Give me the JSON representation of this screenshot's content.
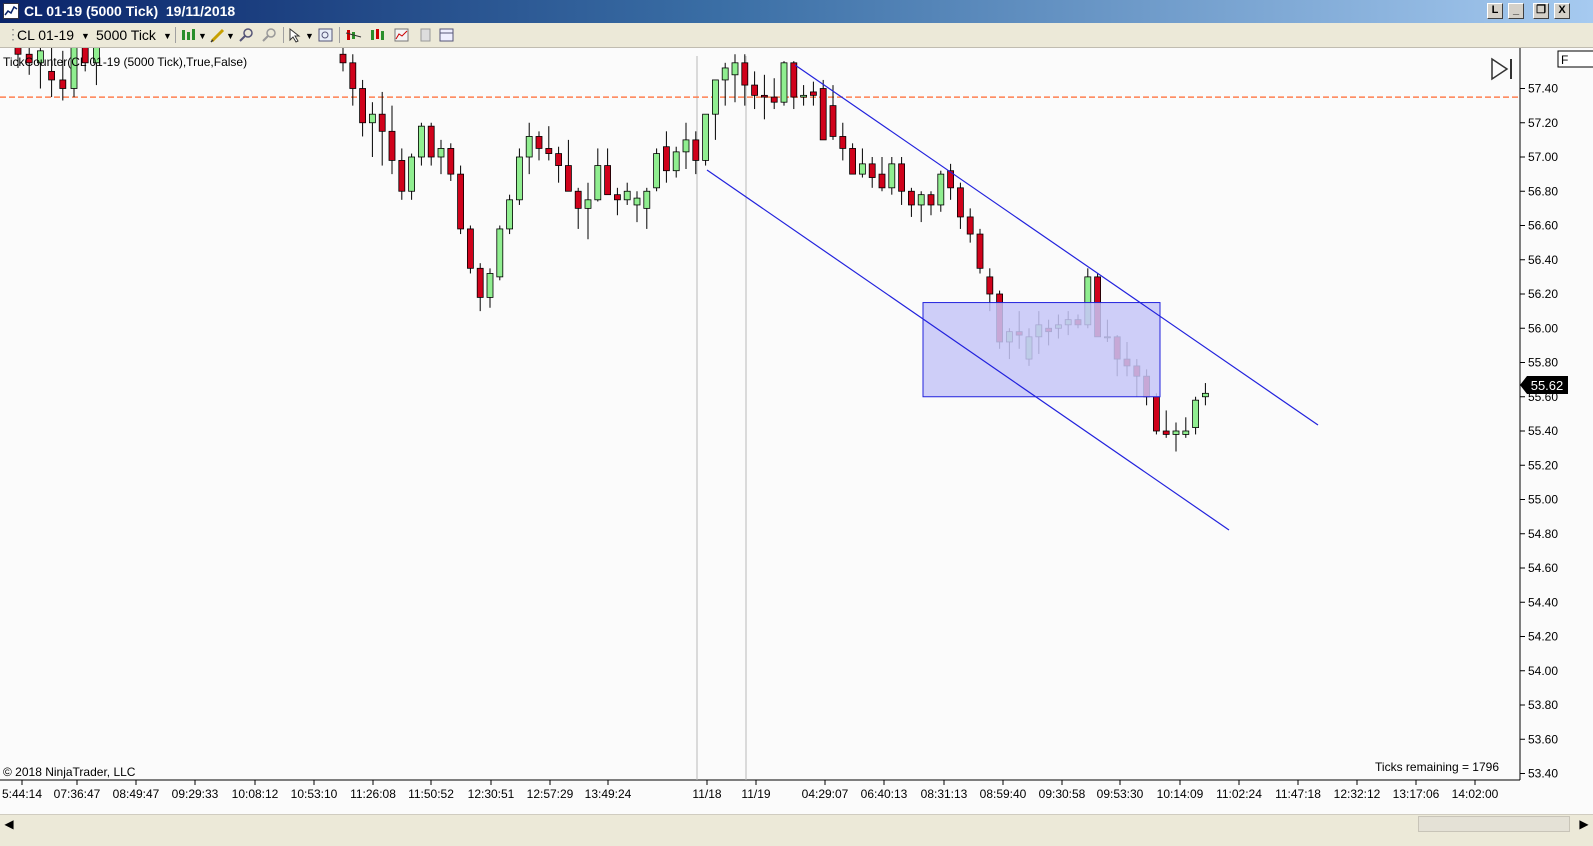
{
  "window": {
    "title": "CL 01-19 (5000 Tick)  19/11/2018",
    "buttons": [
      "L",
      "_",
      "❐",
      "X"
    ]
  },
  "toolbar": {
    "instrument": "CL 01-19",
    "period": "5000 Tick"
  },
  "indicator_label": "TickCounter(CL 01-19 (5000 Tick),True,False)",
  "copyright": "© 2018 NinjaTrader, LLC",
  "ticks_remaining": "Ticks remaining = 1796",
  "last_price": "55.62",
  "price_axis_partial_label": "F",
  "colors": {
    "up_candle": "#90ee90",
    "down_candle": "#d0021b",
    "channel": "#2222dd",
    "zone_fill": "#c5c5f7",
    "level_line": "#ff7f50"
  },
  "chart_data": {
    "type": "candlestick",
    "ylim": [
      53.3,
      57.6
    ],
    "y_ticks": [
      57.4,
      57.2,
      57.0,
      56.8,
      56.6,
      56.4,
      56.2,
      56.0,
      55.8,
      55.6,
      55.4,
      55.2,
      55.0,
      54.8,
      54.6,
      54.4,
      54.2,
      54.0,
      53.8,
      53.6,
      53.4
    ],
    "x_tick_labels": [
      "5:44:14",
      "07:36:47",
      "08:49:47",
      "09:29:33",
      "10:08:12",
      "10:53:10",
      "11:26:08",
      "11:50:52",
      "12:30:51",
      "12:57:29",
      "13:49:24",
      "11/18",
      "11/19",
      "04:29:07",
      "06:40:13",
      "08:31:13",
      "08:59:40",
      "09:30:58",
      "09:53:30",
      "10:14:09",
      "11:02:24",
      "11:47:18",
      "12:32:12",
      "13:17:06",
      "14:02:00"
    ],
    "session_breaks": [
      "11/18",
      "11/19"
    ],
    "horizontal_level": 57.35,
    "last_price": 55.62,
    "channel": {
      "upper": [
        [
          57.5,
          0
        ],
        [
          55.4,
          1
        ]
      ],
      "lower": [
        [
          56.9,
          0
        ],
        [
          54.75,
          1
        ]
      ]
    },
    "zone": {
      "top": 56.15,
      "bottom": 55.6
    },
    "ohlc": [
      [
        57.68,
        57.78,
        57.52,
        57.6
      ],
      [
        57.6,
        57.72,
        57.48,
        57.55
      ],
      [
        57.55,
        57.68,
        57.4,
        57.62
      ],
      [
        57.5,
        57.65,
        57.35,
        57.45
      ],
      [
        57.45,
        57.62,
        57.33,
        57.4
      ],
      [
        57.4,
        57.8,
        57.35,
        57.7
      ],
      [
        57.7,
        57.78,
        57.5,
        57.55
      ],
      [
        57.55,
        57.74,
        57.42,
        57.64
      ],
      [
        57.6,
        57.75,
        57.5,
        57.55
      ],
      [
        57.55,
        57.6,
        57.3,
        57.4
      ],
      [
        57.4,
        57.45,
        57.12,
        57.2
      ],
      [
        57.2,
        57.32,
        57.0,
        57.25
      ],
      [
        57.25,
        57.38,
        56.95,
        57.15
      ],
      [
        57.15,
        57.3,
        56.9,
        56.98
      ],
      [
        56.98,
        57.05,
        56.75,
        56.8
      ],
      [
        56.8,
        57.02,
        56.75,
        57.0
      ],
      [
        57.0,
        57.2,
        56.95,
        57.18
      ],
      [
        57.18,
        57.2,
        56.95,
        57.0
      ],
      [
        57.0,
        57.1,
        56.9,
        57.05
      ],
      [
        57.05,
        57.08,
        56.86,
        56.9
      ],
      [
        56.9,
        56.95,
        56.55,
        56.58
      ],
      [
        56.58,
        56.6,
        56.32,
        56.35
      ],
      [
        56.35,
        56.38,
        56.1,
        56.18
      ],
      [
        56.18,
        56.35,
        56.12,
        56.32
      ],
      [
        56.3,
        56.6,
        56.28,
        56.58
      ],
      [
        56.58,
        56.78,
        56.55,
        56.75
      ],
      [
        56.75,
        57.05,
        56.72,
        57.0
      ],
      [
        57.0,
        57.2,
        56.9,
        57.12
      ],
      [
        57.12,
        57.15,
        56.98,
        57.05
      ],
      [
        57.05,
        57.18,
        56.98,
        57.02
      ],
      [
        57.02,
        57.06,
        56.85,
        56.95
      ],
      [
        56.95,
        57.1,
        56.8,
        56.8
      ],
      [
        56.8,
        56.82,
        56.58,
        56.7
      ],
      [
        56.7,
        56.85,
        56.52,
        56.75
      ],
      [
        56.75,
        57.05,
        56.74,
        56.95
      ],
      [
        56.95,
        57.05,
        56.82,
        56.78
      ],
      [
        56.78,
        56.82,
        56.66,
        56.75
      ],
      [
        56.75,
        56.85,
        56.72,
        56.8
      ],
      [
        56.72,
        56.8,
        56.62,
        56.76
      ],
      [
        56.7,
        56.82,
        56.58,
        56.8
      ],
      [
        56.82,
        57.05,
        56.8,
        57.02
      ],
      [
        57.06,
        57.15,
        56.85,
        56.92
      ],
      [
        56.92,
        57.06,
        56.88,
        57.03
      ],
      [
        57.03,
        57.2,
        56.93,
        57.1
      ],
      [
        57.1,
        57.15,
        56.9,
        56.98
      ],
      [
        56.98,
        57.25,
        56.95,
        57.25
      ],
      [
        57.25,
        57.45,
        57.1,
        57.45
      ],
      [
        57.45,
        57.55,
        57.3,
        57.52
      ],
      [
        57.48,
        57.6,
        57.32,
        57.55
      ],
      [
        57.55,
        57.6,
        57.3,
        57.42
      ],
      [
        57.42,
        57.5,
        57.28,
        57.36
      ],
      [
        57.36,
        57.48,
        57.22,
        57.35
      ],
      [
        57.35,
        57.46,
        57.28,
        57.32
      ],
      [
        57.32,
        57.56,
        57.3,
        57.55
      ],
      [
        57.55,
        57.56,
        57.28,
        57.35
      ],
      [
        57.35,
        57.42,
        57.3,
        57.36
      ],
      [
        57.38,
        57.44,
        57.3,
        57.36
      ],
      [
        57.4,
        57.45,
        57.12,
        57.1
      ],
      [
        57.3,
        57.42,
        57.1,
        57.12
      ],
      [
        57.12,
        57.2,
        56.98,
        57.05
      ],
      [
        57.05,
        57.08,
        56.9,
        56.9
      ],
      [
        56.9,
        57.05,
        56.88,
        56.96
      ],
      [
        56.96,
        57.0,
        56.82,
        56.88
      ],
      [
        56.9,
        57.0,
        56.8,
        56.82
      ],
      [
        56.82,
        57.0,
        56.78,
        56.96
      ],
      [
        56.96,
        57.0,
        56.72,
        56.8
      ],
      [
        56.8,
        56.82,
        56.65,
        56.72
      ],
      [
        56.72,
        56.8,
        56.62,
        56.78
      ],
      [
        56.78,
        56.8,
        56.66,
        56.72
      ],
      [
        56.72,
        56.92,
        56.68,
        56.9
      ],
      [
        56.92,
        56.96,
        56.75,
        56.82
      ],
      [
        56.82,
        56.85,
        56.58,
        56.65
      ],
      [
        56.65,
        56.7,
        56.5,
        56.55
      ],
      [
        56.55,
        56.58,
        56.32,
        56.35
      ],
      [
        56.3,
        56.35,
        56.1,
        56.2
      ],
      [
        56.2,
        56.22,
        55.88,
        55.92
      ],
      [
        55.92,
        56.0,
        55.82,
        55.98
      ],
      [
        55.98,
        56.1,
        55.88,
        55.96
      ],
      [
        55.82,
        56.0,
        55.78,
        55.95
      ],
      [
        55.95,
        56.1,
        55.85,
        56.02
      ],
      [
        56.0,
        56.05,
        55.9,
        55.98
      ],
      [
        56.0,
        56.08,
        55.94,
        56.02
      ],
      [
        56.02,
        56.1,
        55.96,
        56.05
      ],
      [
        56.05,
        56.08,
        56.0,
        56.02
      ],
      [
        56.02,
        56.35,
        56.0,
        56.3
      ],
      [
        56.3,
        56.32,
        55.95,
        55.95
      ],
      [
        55.95,
        56.05,
        55.92,
        55.95
      ],
      [
        55.95,
        55.96,
        55.72,
        55.82
      ],
      [
        55.82,
        55.92,
        55.72,
        55.78
      ],
      [
        55.78,
        55.82,
        55.6,
        55.72
      ],
      [
        55.72,
        55.76,
        55.55,
        55.6
      ],
      [
        55.6,
        55.62,
        55.38,
        55.4
      ],
      [
        55.4,
        55.52,
        55.36,
        55.38
      ],
      [
        55.38,
        55.45,
        55.28,
        55.4
      ],
      [
        55.38,
        55.48,
        55.36,
        55.4
      ],
      [
        55.42,
        55.6,
        55.38,
        55.58
      ],
      [
        55.6,
        55.68,
        55.55,
        55.62
      ]
    ]
  }
}
